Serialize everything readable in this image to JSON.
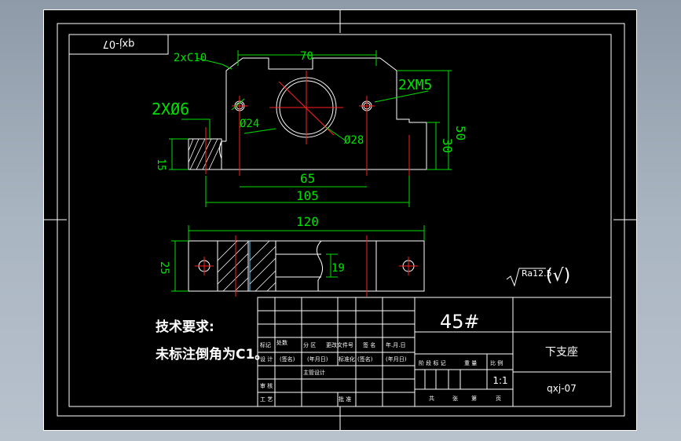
{
  "drawing": {
    "code_rotated": "qxj-07",
    "material": "45#",
    "part_name": "下支座",
    "drawing_code": "qxj-07",
    "scale": "1:1",
    "roughness": "Ra12.5",
    "roughness_check": "(√)"
  },
  "tech": {
    "title": "技术要求:",
    "line1": "未标注倒角为C1。"
  },
  "dims": {
    "chamfer": "2xC10",
    "d70": "70",
    "d2xm5": "2XM5",
    "d2xphi6": "2XØ6",
    "phi24": "Ø24",
    "phi28": "Ø28",
    "d50": "50",
    "d30": "30",
    "d15": "15",
    "d65": "65",
    "d105": "105",
    "d120": "120",
    "d25": "25",
    "d19": "19"
  },
  "titleblock": {
    "biaoji": "标记",
    "chushu": "处数",
    "fenqu": "分 区",
    "gengai": "更改文件号",
    "qianming": "签 名",
    "nianyueri": "年.月.日",
    "sheji": "设 计",
    "qianming2": "(签名)",
    "nianyueri2": "(年月日)",
    "biaozhunhua": "标准化",
    "qianming3": "(签名)",
    "nianyueri3": "(年月日)",
    "jieduan": "阶 段 标 记",
    "zhongliang": "重 量",
    "bili": "比 例",
    "zhuguan": "主管设计",
    "shenhe": "审 核",
    "gongyi": "工 艺",
    "pizhun": "批 准",
    "gong": "共",
    "zhang": "张",
    "di": "第",
    "ye": "页"
  }
}
